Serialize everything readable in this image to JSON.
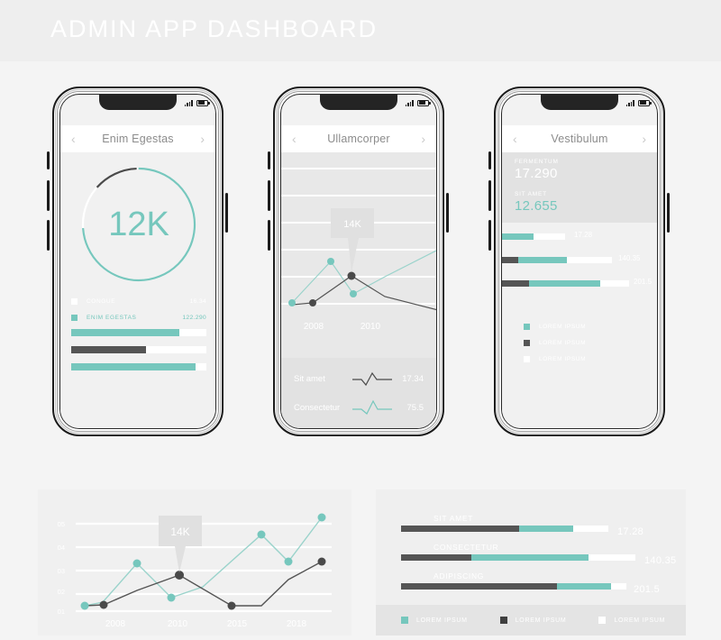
{
  "header": {
    "title": "ADMIN APP DASHBOARD"
  },
  "colors": {
    "teal": "#76c7bd",
    "dark": "#555555",
    "white": "#ffffff",
    "page_bg": "#f4f4f4",
    "panel_bg": "#f0f0f0",
    "muted_text": "#8c8c8c"
  },
  "icons": {
    "signal": "signal-bars-icon",
    "battery": "battery-icon",
    "prev": "chevron-left-icon",
    "next": "chevron-right-icon"
  },
  "phones": [
    {
      "nav": {
        "title": "Enim Egestas",
        "prev": "‹",
        "next": "›"
      },
      "donut": {
        "center_value": "12K",
        "teal_percent": 74,
        "dark_percent": 13,
        "gap_percent": 13
      },
      "legend": [
        {
          "label": "CONGUE",
          "value": "16.34",
          "swatch": "#ffffff",
          "text_color": "#ffffff"
        },
        {
          "label": "ENIM EGESTAS",
          "value": "122.290",
          "swatch": "#76c7bd",
          "text_color": "#76c7bd"
        }
      ],
      "bars": [
        {
          "fill": "#76c7bd",
          "percent": 80
        },
        {
          "fill": "#555555",
          "percent": 55
        },
        {
          "fill": "#76c7bd",
          "percent": 92
        }
      ]
    },
    {
      "nav": {
        "title": "Ullamcorper",
        "prev": "‹",
        "next": "›"
      },
      "tooltip": "14K",
      "xticks": [
        "2008",
        "2010"
      ],
      "stats": [
        {
          "label": "Sit amet",
          "value": "17.34",
          "color": "#555555"
        },
        {
          "label": "Consectetur",
          "value": "75.5",
          "color": "#76c7bd"
        }
      ]
    },
    {
      "nav": {
        "title": "Vestibulum",
        "prev": "‹",
        "next": "›"
      },
      "kpis": [
        {
          "label": "FERMENTUM",
          "value": "17.290",
          "color": "#ffffff"
        },
        {
          "label": "SIT AMET",
          "value": "12.655",
          "color": "#76c7bd"
        }
      ],
      "bars": [
        {
          "value": "17.28",
          "dark": 0,
          "teal": 26,
          "white": 26
        },
        {
          "value": "140.35",
          "dark": 13,
          "teal": 39,
          "white": 38
        },
        {
          "value": "201.5",
          "dark": 22,
          "teal": 52,
          "white": 18
        }
      ],
      "legend": [
        {
          "label": "LOREM IPSUM",
          "swatch": "#76c7bd"
        },
        {
          "label": "LOREM IPSUM",
          "swatch": "#555555"
        },
        {
          "label": "LOREM IPSUM",
          "swatch": "#ffffff"
        }
      ]
    }
  ],
  "chart_data": [
    {
      "type": "line",
      "title": "",
      "tooltip": "14K",
      "xlabel": "",
      "ylabel": "",
      "xticks": [
        "2008",
        "2010",
        "2015",
        "2018"
      ],
      "yticks": [
        "01",
        "02",
        "03",
        "04",
        "05"
      ],
      "ylim": [
        1,
        5
      ],
      "grid": true,
      "legend_position": "none",
      "series": [
        {
          "name": "teal-series",
          "color": "#76c7bd",
          "values": [
            1.4,
            2.0,
            3.3,
            1.7,
            2.7,
            4.6,
            3.45,
            5.35
          ]
        },
        {
          "name": "dark-series",
          "color": "#555555",
          "values": [
            1.4,
            1.9,
            2.35,
            2.75,
            2.1,
            1.4,
            2.4,
            3.4
          ]
        }
      ]
    },
    {
      "type": "bar",
      "title": "",
      "categories": [
        "SIT AMET",
        "CONSECTETUR",
        "ADIPISCING"
      ],
      "values": [
        17.28,
        140.35,
        201.5
      ],
      "value_labels": [
        "17.28",
        "140.35",
        "201.5"
      ],
      "stack_segments": [
        {
          "dark": 57,
          "teal": 26,
          "white": 17
        },
        {
          "dark": 30,
          "teal": 50,
          "white": 20
        },
        {
          "dark": 69,
          "teal": 24,
          "white": 7
        }
      ],
      "xlabel": "",
      "ylabel": "",
      "grid": false,
      "legend_position": "bottom",
      "legend": [
        {
          "label": "LOREM IPSUM",
          "swatch": "#76c7bd"
        },
        {
          "label": "LOREM IPSUM",
          "swatch": "#555555"
        },
        {
          "label": "LOREM IPSUM",
          "swatch": "#ffffff"
        }
      ]
    },
    {
      "type": "line",
      "title": "",
      "tooltip": "14K",
      "xticks": [
        "2008",
        "2010"
      ],
      "grid": true,
      "series": [
        {
          "name": "teal-series",
          "color": "#76c7bd",
          "values": [
            1.2,
            3.2,
            1.6,
            2.6,
            4.2
          ]
        },
        {
          "name": "dark-series",
          "color": "#555555",
          "values": [
            1.15,
            1.9,
            2.6,
            1.9,
            1.2
          ]
        }
      ]
    },
    {
      "type": "pie",
      "title": "",
      "center_label": "12K",
      "slices": [
        {
          "name": "teal",
          "percent": 74,
          "color": "#76c7bd"
        },
        {
          "name": "dark",
          "percent": 13,
          "color": "#555555"
        },
        {
          "name": "gap",
          "percent": 13,
          "color": "#ffffff"
        }
      ]
    }
  ]
}
